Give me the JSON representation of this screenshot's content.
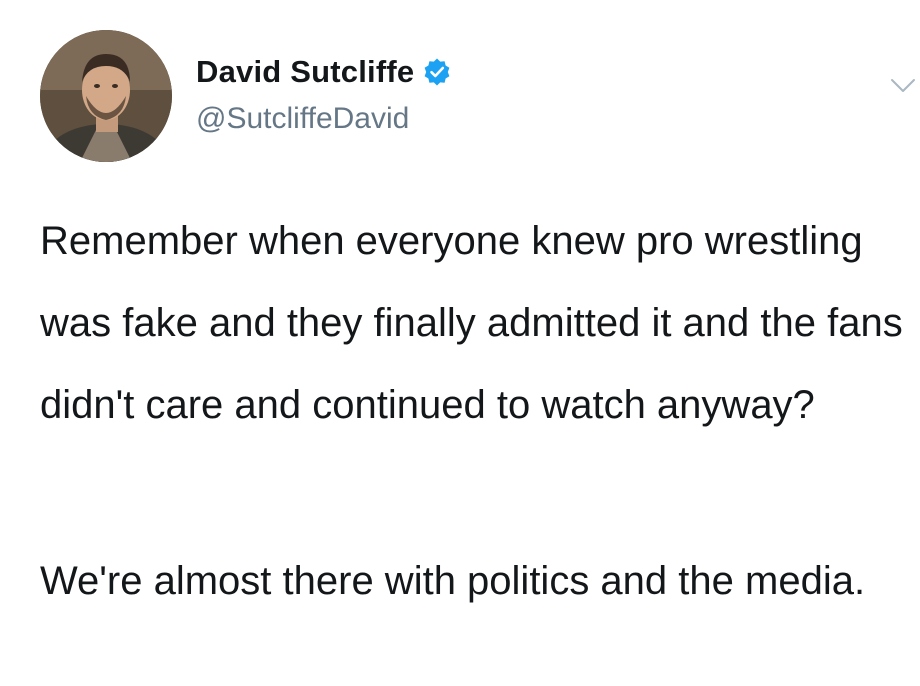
{
  "tweet": {
    "author": {
      "display_name": "David Sutcliffe",
      "handle": "@SutcliffeDavid",
      "verified": true,
      "avatar_icon": "profile-photo"
    },
    "paragraphs": [
      "Remember when everyone knew pro wrestling was fake and they finally admitted it and the fans didn't care and continued to watch anyway?",
      "We're almost there with politics and the media."
    ],
    "menu_icon": "chevron-down-icon"
  },
  "colors": {
    "text": "#14171a",
    "handle": "#657786",
    "verified": "#1da1f2",
    "background": "#ffffff"
  }
}
